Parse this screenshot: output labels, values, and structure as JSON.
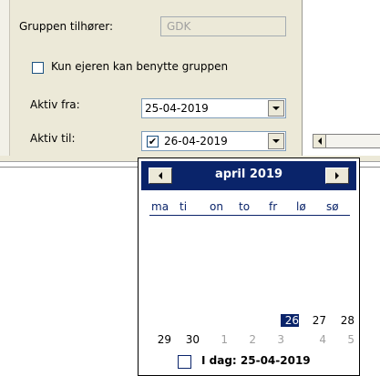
{
  "form": {
    "group_owner_label": "Gruppen tilhører:",
    "group_owner_value": "GDK",
    "only_owner_label": "Kun ejeren kan benytte gruppen",
    "active_from_label": "Aktiv fra:",
    "active_from_value": "25-04-2019",
    "active_to_label": "Aktiv til:",
    "active_to_checked": "✔",
    "active_to_value": "26-04-2019"
  },
  "calendar": {
    "month_title": "april 2019",
    "weekdays": [
      "ma",
      "ti",
      "on",
      "to",
      "fr",
      "lø",
      "sø"
    ],
    "row5": [
      "26",
      "27",
      "28"
    ],
    "row6": [
      "29",
      "30",
      "1",
      "2",
      "3",
      "4",
      "5"
    ],
    "selected_day": "26",
    "today_text": "I dag: 25-04-2019"
  }
}
